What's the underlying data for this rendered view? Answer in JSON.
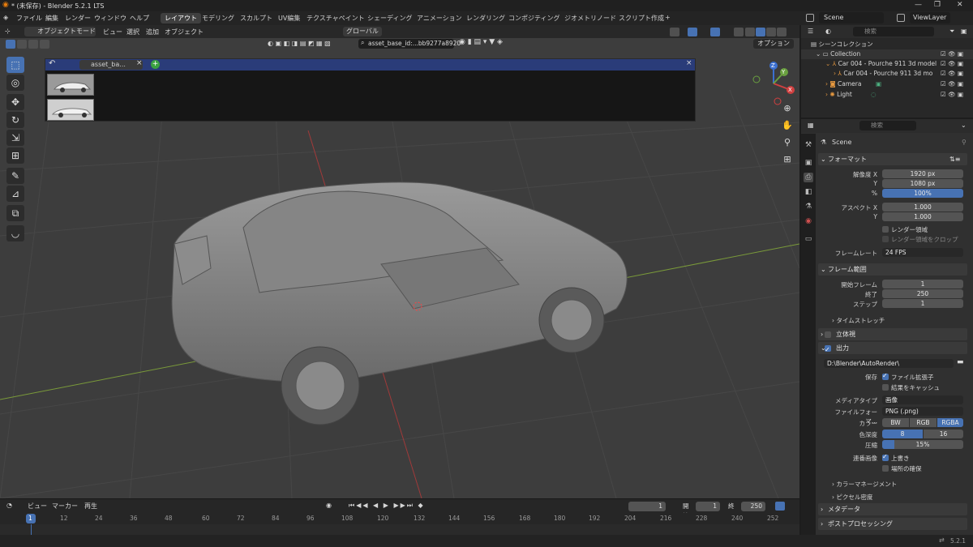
{
  "titlebar": {
    "title": "* (未保存) - Blender 5.2.1 LTS",
    "min": "—",
    "max": "❐",
    "close": "✕"
  },
  "menu": {
    "items": [
      "ファイル",
      "編集",
      "レンダー",
      "ウィンドウ",
      "ヘルプ"
    ],
    "workspaces": [
      "レイアウト",
      "モデリング",
      "スカルプト",
      "UV編集",
      "テクスチャペイント",
      "シェーディング",
      "アニメーション",
      "レンダリング",
      "コンポジティング",
      "ジオメトリノード",
      "スクリプト作成",
      "+"
    ],
    "scene": "Scene",
    "view_layer": "ViewLayer"
  },
  "viewport": {
    "mode": "オブジェクトモード",
    "menus": [
      "ビュー",
      "選択",
      "追加",
      "オブジェクト"
    ],
    "transform": "グローバル",
    "options": "オプション",
    "asset_search": "asset_base_id:...bb9277a8920"
  },
  "asset_browser": {
    "tab_label": "asset_ba...",
    "close": "×",
    "back": "↶",
    "add": "+",
    "thumbnails": [
      "car-thumbnail-1",
      "car-thumbnail-2"
    ]
  },
  "gizmo": {
    "x": "X",
    "y": "Y",
    "z": "Z"
  },
  "timeline": {
    "menus": [
      "ビュー",
      "マーカー",
      "再生"
    ],
    "current_frame": "1",
    "start_label": "開始",
    "start": "1",
    "end_label": "終了",
    "end": "250",
    "ticks": [
      "1",
      "12",
      "24",
      "36",
      "48",
      "60",
      "72",
      "84",
      "96",
      "108",
      "120",
      "132",
      "144",
      "156",
      "168",
      "180",
      "192",
      "204",
      "216",
      "228",
      "240",
      "252"
    ]
  },
  "outliner": {
    "search_placeholder": "検索",
    "rows": [
      {
        "label": "シーンコレクション"
      },
      {
        "label": "Collection"
      },
      {
        "label": "Car 004 - Pourche 911 3d model"
      },
      {
        "label": "Car 004 - Pourche 911 3d mo"
      },
      {
        "label": "Camera"
      },
      {
        "label": "Light"
      }
    ]
  },
  "properties": {
    "search_placeholder": "検索",
    "scene_name": "Scene",
    "format": {
      "title": "フォーマット",
      "res_x_label": "解像度 X",
      "res_x": "1920 px",
      "res_y_label": "Y",
      "res_y": "1080 px",
      "pct_label": "%",
      "pct": "100%",
      "aspect_x_label": "アスペクト X",
      "aspect_x": "1.000",
      "aspect_y_label": "Y",
      "aspect_y": "1.000",
      "render_region": "レンダー領域",
      "crop": "レンダー領域をクロップ",
      "fps_label": "フレームレート",
      "fps": "24 FPS"
    },
    "frame_range": {
      "title": "フレーム範囲",
      "start_label": "開始フレーム",
      "start": "1",
      "end_label": "終了",
      "end": "250",
      "step_label": "ステップ",
      "step": "1",
      "time_stretch": "タイムストレッチ"
    },
    "stereo": "立体視",
    "output": {
      "title": "出力",
      "path": "D:\\Blender\\AutoRender\\",
      "save_label": "保存",
      "file_ext": "ファイル拡張子",
      "cache": "結果をキャッシュ",
      "media_label": "メディアタイプ",
      "media": "画像",
      "format_label": "ファイルフォーマ...",
      "format": "PNG (.png)",
      "color_label": "カラー",
      "colors": [
        "BW",
        "RGB",
        "RGBA"
      ],
      "depth_label": "色深度",
      "depths": [
        "8",
        "16"
      ],
      "compress_label": "圧縮",
      "compress": "15%",
      "compress_fraction": 0.15,
      "seq_label": "連番画像",
      "overwrite": "上書き",
      "placeholders": "場所の確保",
      "color_mgmt": "カラーマネージメント",
      "pixel_density": "ピクセル密度"
    },
    "metadata": "メタデータ",
    "post": "ポストプロセッシング"
  },
  "status": {
    "version": "5.2.1"
  },
  "colors": {
    "accent": "#4772b3",
    "asset_bar": "#2a3c79",
    "viewport": "#3d3d3d"
  }
}
